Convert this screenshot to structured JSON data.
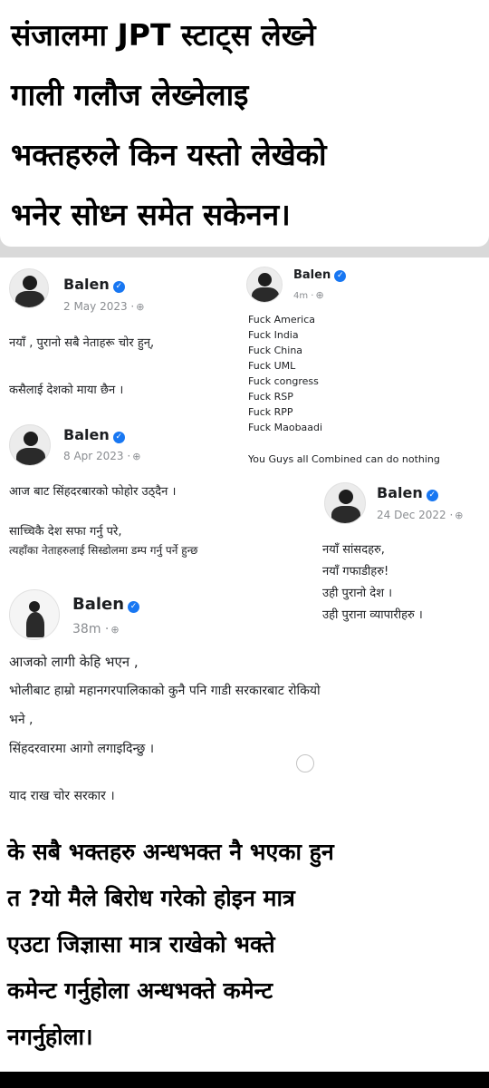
{
  "header_caption": {
    "lines": [
      "संजालमा JPT स्टाट्स लेख्ने",
      "गाली गलौज लेख्नेलाइ",
      "भक्तहरुले किन यस्तो लेखेको",
      "भनेर  सोध्न समेत सकेनन।"
    ]
  },
  "posts": [
    {
      "name": "Balen",
      "meta": "2 May 2023 ·",
      "lines": [
        "नयाँ , पुरानो सबै नेताहरू चोर हुन्,",
        "",
        "कसैलाई देशको माया छैन ।"
      ]
    },
    {
      "name": "Balen",
      "meta": "4m ·",
      "lines": [
        "Fuck America",
        "Fuck India",
        "Fuck China",
        "Fuck UML",
        "Fuck  congress",
        "Fuck RSP",
        "Fuck RPP",
        "Fuck Maobaadi",
        "",
        "You Guys all Combined can do nothing"
      ]
    },
    {
      "name": "Balen",
      "meta": "8 Apr 2023 ·",
      "lines": [
        "आज बाट सिंहदरबारको फोहोर उठ्दैन ।",
        "",
        "साच्चिकै देश सफा गर्नु परे,",
        "त्यहाँका नेताहरुलाई सिस्डोलमा डम्प गर्नु पर्ने हुन्छ"
      ]
    },
    {
      "name": "Balen",
      "meta": "24 Dec 2022 ·",
      "lines": [
        "नयाँ सांसदहरु,",
        "नयाँ गफाडीहरु!",
        "उही पुरानो देश ।",
        "उही पुराना व्यापारीहरु ।"
      ]
    },
    {
      "name": "Balen",
      "meta": "38m ·",
      "lines": [
        "आजको लागी केहि भएन ,",
        "भोलीबाट हाम्रो महानगरपालिकाको कुनै पनि गाडी सरकारबाट रोकियो",
        "भने ,",
        "सिंहदरवारमा आगो लगाइदिन्छु ।",
        "",
        "याद राख चोर सरकार ।"
      ]
    }
  ],
  "footer_caption": {
    "lines": [
      "के सबै भक्तहरु अन्धभक्त नै भएका हुन",
      "त ?यो मैले बिरोध गरेको होइन मात्र",
      "एउटा जिज्ञासा मात्र राखेको भक्ते",
      "कमेन्ट गर्नुहोला अन्धभक्ते कमेन्ट",
      "नगर्नुहोला।"
    ]
  },
  "icons": {
    "verified": "verified-badge-icon",
    "audience": "globe-icon"
  },
  "colors": {
    "verified_blue": "#1877f2",
    "meta_gray": "#8a8d91",
    "text_dark": "#1c1e21"
  }
}
